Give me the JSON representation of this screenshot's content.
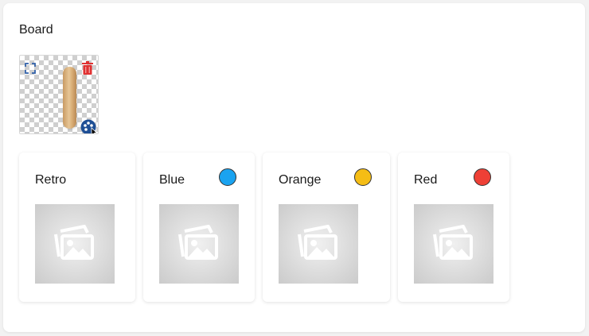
{
  "board": {
    "title": "Board",
    "icons": {
      "fullscreen": "fullscreen-corners-icon",
      "delete": "trash-icon",
      "palette": "palette-icon"
    }
  },
  "cards": [
    {
      "label": "Retro",
      "color": null
    },
    {
      "label": "Blue",
      "color": "#1aa3f0"
    },
    {
      "label": "Orange",
      "color": "#f5bd15"
    },
    {
      "label": "Red",
      "color": "#ee4036"
    }
  ],
  "colors": {
    "delete": "#e03131",
    "fullscreen": "#2f5fa8",
    "palette": "#1f4f95"
  }
}
